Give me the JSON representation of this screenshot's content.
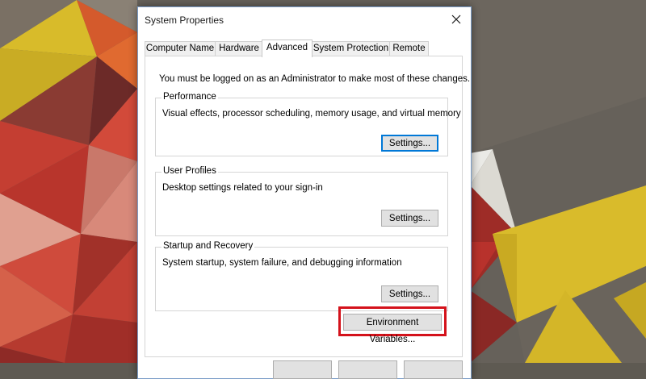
{
  "window": {
    "title": "System Properties"
  },
  "tabs": [
    {
      "label": "Computer Name"
    },
    {
      "label": "Hardware"
    },
    {
      "label": "Advanced"
    },
    {
      "label": "System Protection"
    },
    {
      "label": "Remote"
    }
  ],
  "active_tab": "Advanced",
  "panel": {
    "admin_note": "You must be logged on as an Administrator to make most of these changes.",
    "groups": [
      {
        "title": "Performance",
        "description": "Visual effects, processor scheduling, memory usage, and virtual memory",
        "button_label": "Settings..."
      },
      {
        "title": "User Profiles",
        "description": "Desktop settings related to your sign-in",
        "button_label": "Settings..."
      },
      {
        "title": "Startup and Recovery",
        "description": "System startup, system failure, and debugging information",
        "button_label": "Settings..."
      }
    ],
    "env_button_label": "Environment Variables..."
  },
  "icons": {
    "close": "close-icon"
  },
  "colors": {
    "highlight": "#d4121b",
    "focus_blue": "#0078d7",
    "wallpaper_red": "#c8483a",
    "wallpaper_yellow": "#d8bb2a",
    "wallpaper_gray": "#6b655c"
  }
}
